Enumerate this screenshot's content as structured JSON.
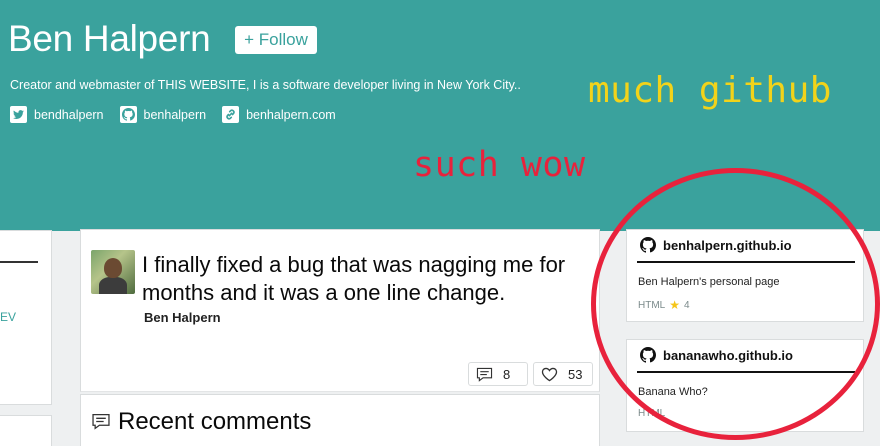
{
  "profile": {
    "name": "Ben Halpern",
    "follow_label": "+ Follow",
    "bio": "Creator and webmaster of THIS WEBSITE, I is a software developer living in New York City..",
    "links": {
      "twitter": "bendhalpern",
      "github": "benhalpern",
      "website": "benhalpern.com"
    }
  },
  "overlay": {
    "meme_top": "much github",
    "meme_bottom": "such wow",
    "colors": {
      "yellow": "#f2d31a",
      "red": "#e8223c"
    }
  },
  "left_column": {
    "partial_link": "EV"
  },
  "post": {
    "title": "I finally fixed a bug that was nagging me for months and it was a one line change.",
    "author": "Ben Halpern",
    "comments_count": "8",
    "likes_count": "53"
  },
  "recent": {
    "title": "Recent comments"
  },
  "repos": [
    {
      "name": "benhalpern.github.io",
      "description": "Ben Halpern's personal page",
      "language": "HTML",
      "stars": "4"
    },
    {
      "name": "bananawho.github.io",
      "description": "Banana Who?",
      "language": "HTML",
      "stars": ""
    }
  ],
  "theme": {
    "accent": "#3aa29d",
    "background": "#eef0f1",
    "card": "#ffffff"
  }
}
